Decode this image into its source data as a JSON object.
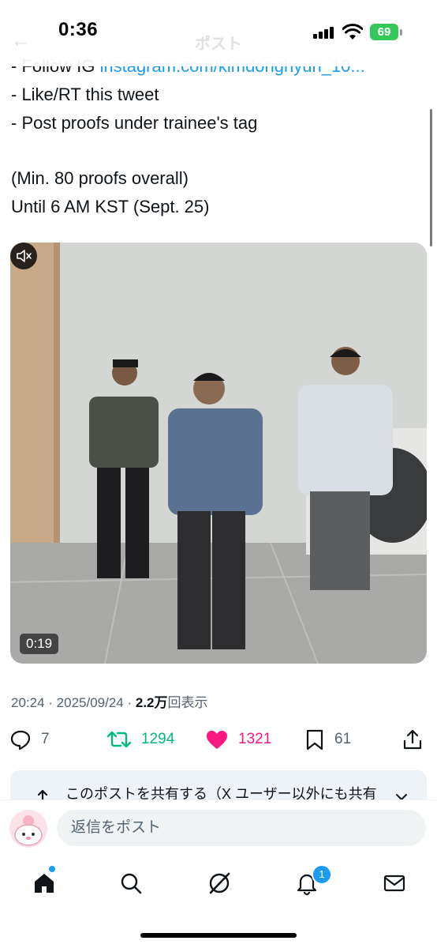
{
  "status": {
    "time": "0:36",
    "battery": "69"
  },
  "header": {
    "title": "ポスト"
  },
  "tweet": {
    "lines": [
      {
        "prefix": "- Follow IG ",
        "link": "instagram.com/kimdonghyun_10..."
      },
      {
        "text": "- Like/RT this tweet"
      },
      {
        "text": "- Post proofs under trainee's tag"
      },
      {
        "text": "(Min. 80 proofs overall)"
      },
      {
        "text": "Until 6 AM KST (Sept. 25)"
      }
    ]
  },
  "video": {
    "duration": "0:19"
  },
  "meta": {
    "time": "20:24",
    "date": "2025/09/24",
    "views": "2.2万",
    "views_label": "回表示",
    "sep": " · "
  },
  "actions": {
    "replies": "7",
    "reposts": "1294",
    "likes": "1321",
    "bookmarks": "61"
  },
  "share_banner": {
    "text": "このポストを共有する（X ユーザー以外にも共有"
  },
  "reply": {
    "placeholder": "返信をポスト"
  },
  "tabbar": {
    "notifications_badge": "1"
  },
  "colors": {
    "accent": "#1d9bf0",
    "repost": "#00ba7c",
    "like": "#f91880",
    "battery": "#34c759"
  }
}
